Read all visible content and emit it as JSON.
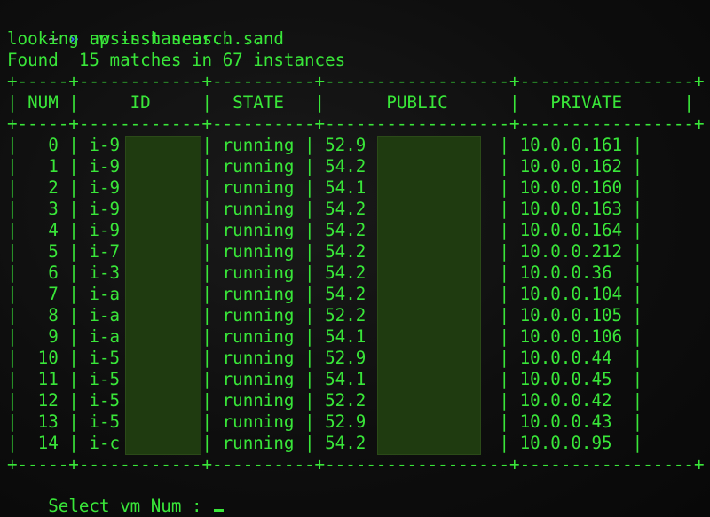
{
  "prompt": {
    "tilde": "~",
    "arrow": "»",
    "command": "aws-ssh search sand"
  },
  "messages": {
    "lookup": "looking up instances.....",
    "found": "Found  15 matches in 67 instances"
  },
  "table": {
    "border": "+-----+------------+----------+------------------+-----------------+",
    "header": "| NUM |     ID     |  STATE   |      PUBLIC      |   PRIVATE      |",
    "rows": [
      "|   0 | i-9        | running | 52.9             | 10.0.0.161 |",
      "|   1 | i-9        | running | 54.2             | 10.0.0.162 |",
      "|   2 | i-9        | running | 54.1             | 10.0.0.160 |",
      "|   3 | i-9        | running | 54.2             | 10.0.0.163 |",
      "|   4 | i-9        | running | 54.2             | 10.0.0.164 |",
      "|   5 | i-7        | running | 54.2             | 10.0.0.212 |",
      "|   6 | i-3        | running | 54.2             | 10.0.0.36  |",
      "|   7 | i-a        | running | 54.2             | 10.0.0.104 |",
      "|   8 | i-a        | running | 52.2             | 10.0.0.105 |",
      "|   9 | i-a        | running | 54.1             | 10.0.0.106 |",
      "|  10 | i-5        | running | 52.9             | 10.0.0.44  |",
      "|  11 | i-5        | running | 54.1             | 10.0.0.45  |",
      "|  12 | i-5        | running | 52.2             | 10.0.0.42  |",
      "|  13 | i-5        | running | 52.9             | 10.0.0.43  |",
      "|  14 | i-c        | running | 54.2             | 10.0.0.95  |"
    ]
  },
  "input": {
    "label": "Select vm Num : "
  },
  "colors": {
    "text": "#39e639",
    "prompt_arrow": "#3b6cff",
    "redaction": "#1f3b10",
    "background": "#0e0e0e"
  }
}
